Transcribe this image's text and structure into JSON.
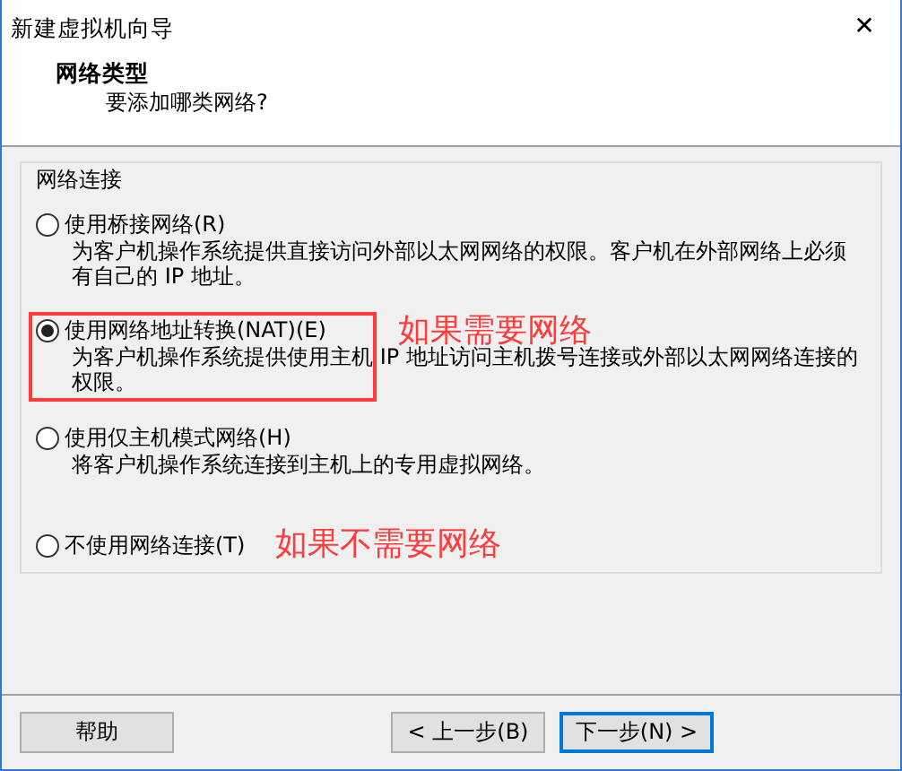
{
  "window": {
    "title": "新建虚拟机向导",
    "close": "✕"
  },
  "header": {
    "title": "网络类型",
    "subtitle": "要添加哪类网络?"
  },
  "group": {
    "label": "网络连接",
    "options": [
      {
        "label": "使用桥接网络(R)",
        "description": "为客户机操作系统提供直接访问外部以太网网络的权限。客户机在外部网络上必须有自己的 IP 地址。",
        "selected": false,
        "highlighted": false
      },
      {
        "label": "使用网络地址转换(NAT)(E)",
        "description": "为客户机操作系统提供使用主机 IP 地址访问主机拨号连接或外部以太网网络连接的权限。",
        "selected": true,
        "highlighted": true,
        "annotation": "如果需要网络"
      },
      {
        "label": "使用仅主机模式网络(H)",
        "description": "将客户机操作系统连接到主机上的专用虚拟网络。",
        "selected": false,
        "highlighted": false
      },
      {
        "label": "不使用网络连接(T)",
        "selected": false,
        "highlighted": false,
        "annotation": "如果不需要网络"
      }
    ]
  },
  "buttons": [
    {
      "label": "帮助",
      "kind": "help",
      "focused": false
    },
    {
      "label": "< 上一步(B)",
      "kind": "nav",
      "focused": false
    },
    {
      "label": "下一步(N) >",
      "kind": "nav",
      "focused": true
    }
  ]
}
